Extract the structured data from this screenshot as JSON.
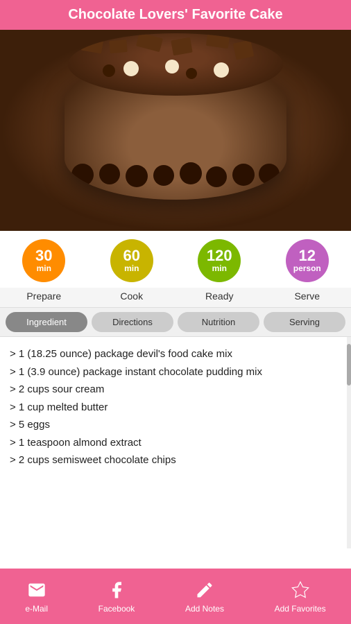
{
  "header": {
    "title": "Chocolate Lovers' Favorite Cake"
  },
  "stats": [
    {
      "id": "prepare",
      "value": "30",
      "unit": "min",
      "color": "orange",
      "label": "Prepare"
    },
    {
      "id": "cook",
      "value": "60",
      "unit": "min",
      "color": "yellow",
      "label": "Cook"
    },
    {
      "id": "ready",
      "value": "120",
      "unit": "min",
      "color": "green",
      "label": "Ready"
    },
    {
      "id": "serve",
      "value": "12",
      "unit": "person",
      "color": "purple",
      "label": "Serve"
    }
  ],
  "tabs": [
    {
      "id": "ingredient",
      "label": "Ingredient",
      "active": true
    },
    {
      "id": "directions",
      "label": "Directions",
      "active": false
    },
    {
      "id": "nutrition",
      "label": "Nutrition",
      "active": false
    },
    {
      "id": "serving",
      "label": "Serving",
      "active": false
    }
  ],
  "ingredients": [
    "> 1 (18.25 ounce) package devil's food cake mix",
    "> 1 (3.9 ounce) package instant chocolate pudding mix",
    "> 2 cups sour cream",
    "> 1 cup melted butter",
    "> 5 eggs",
    "> 1 teaspoon almond extract",
    "> 2 cups semisweet chocolate chips"
  ],
  "bottom_nav": [
    {
      "id": "email",
      "icon": "email",
      "label": "e-Mail"
    },
    {
      "id": "facebook",
      "icon": "facebook",
      "label": "Facebook"
    },
    {
      "id": "add-notes",
      "icon": "notes",
      "label": "Add Notes"
    },
    {
      "id": "add-favorites",
      "icon": "star",
      "label": "Add Favorites"
    }
  ]
}
